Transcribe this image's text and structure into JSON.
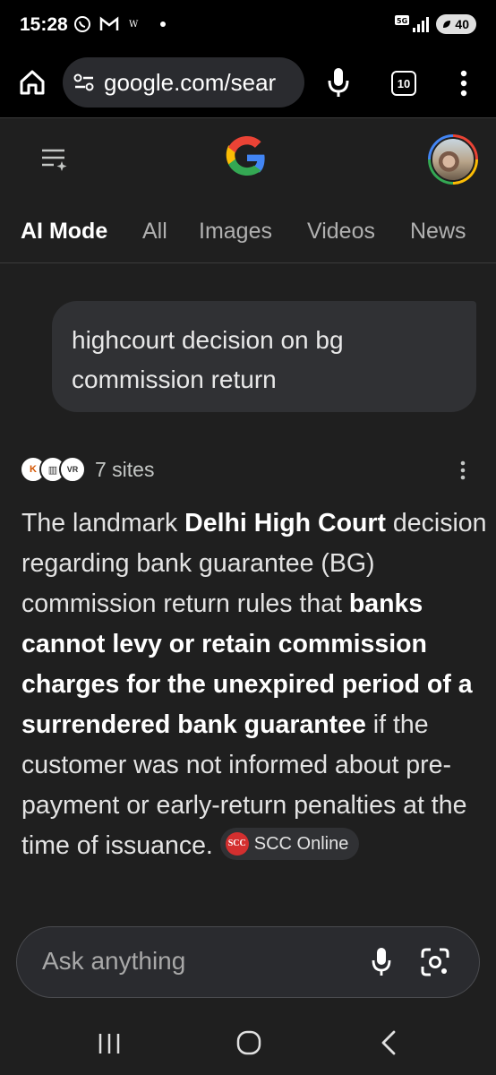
{
  "status_bar": {
    "time": "15:28",
    "network": "5G",
    "battery": "40"
  },
  "browser": {
    "url": "google.com/sear",
    "tab_count": "10"
  },
  "tabs": [
    {
      "label": "AI Mode",
      "active": true
    },
    {
      "label": "All",
      "active": false
    },
    {
      "label": "Images",
      "active": false
    },
    {
      "label": "Videos",
      "active": false
    },
    {
      "label": "News",
      "active": false
    }
  ],
  "query": {
    "text": "highcourt decision on bg commission return"
  },
  "sources": {
    "label": "7 sites"
  },
  "answer": {
    "part1": "The landmark ",
    "bold1": "Delhi High Court",
    "part2": " decision regarding bank guarantee (BG) commission return rules that ",
    "bold2": "banks cannot levy or retain commission charges for the unexpired period of a surrendered bank guarantee",
    "part3": " if the customer was not informed about pre-payment or early-return penalties at the time of issuance. ",
    "citation": "SCC Online",
    "citation_logo": "SCC"
  },
  "ask_bar": {
    "placeholder": "Ask anything"
  },
  "colors": {
    "background": "#1f1f1f",
    "bubble": "#303134",
    "google_blue": "#4285f4",
    "google_red": "#ea4335",
    "google_yellow": "#fbbc05",
    "google_green": "#34a853"
  }
}
